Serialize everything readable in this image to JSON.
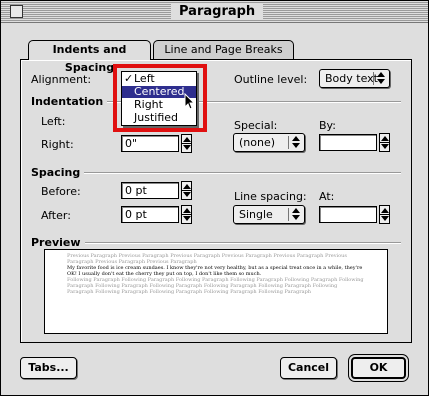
{
  "window": {
    "title": "Paragraph"
  },
  "tabs": [
    {
      "label": "Indents and Spacing",
      "active": true
    },
    {
      "label": "Line and Page Breaks",
      "active": false
    }
  ],
  "alignment": {
    "label": "Alignment:",
    "options": [
      "Left",
      "Centered",
      "Right",
      "Justified"
    ],
    "checked": "Left",
    "highlighted": "Centered"
  },
  "outline": {
    "label": "Outline level:",
    "value": "Body text"
  },
  "indentation": {
    "section": "Indentation",
    "left_label": "Left:",
    "right_label": "Right:",
    "right_value": "0\"",
    "special_label": "Special:",
    "special_value": "(none)",
    "by_label": "By:",
    "by_value": ""
  },
  "spacing": {
    "section": "Spacing",
    "before_label": "Before:",
    "before_value": "0 pt",
    "after_label": "After:",
    "after_value": "0 pt",
    "line_spacing_label": "Line spacing:",
    "line_spacing_value": "Single",
    "at_label": "At:",
    "at_value": ""
  },
  "preview": {
    "section": "Preview",
    "prev_text": "Previous Paragraph Previous Paragraph Previous Paragraph Previous Paragraph Previous Paragraph Previous Paragraph Previous Paragraph Previous Paragraph",
    "current_text": "My favorite food is ice cream sundaes. I know they're not very healthy, but as a special treat once in a while, they're OK! I usually don't eat the cherry they put on top, I don't like them so much.",
    "following_text": "Following Paragraph Following Paragraph Following Paragraph Following Paragraph Following Paragraph Following Paragraph Following Paragraph Following Paragraph Following Paragraph Following Paragraph Following Paragraph Following Paragraph Following Paragraph Following Paragraph Following Paragraph"
  },
  "buttons": {
    "tabs": "Tabs...",
    "cancel": "Cancel",
    "ok": "OK"
  },
  "colors": {
    "highlight": "#2e2e8e",
    "annotation": "#e01010"
  }
}
